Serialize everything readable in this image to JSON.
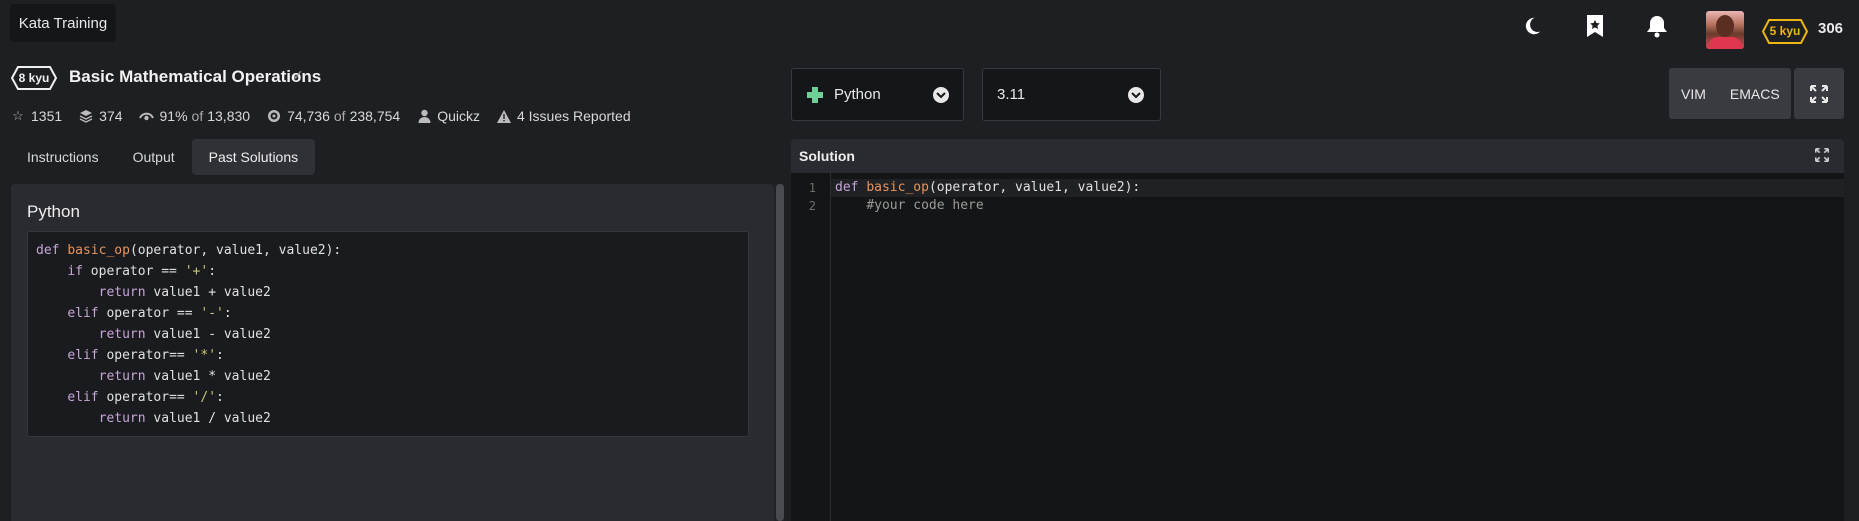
{
  "nav": {
    "brand": "Kata Training",
    "rank_badge": "5 kyu",
    "honor": "306",
    "rank_color": "#ecb613"
  },
  "kata": {
    "kyu": "8 kyu",
    "title": "Basic Mathematical Operations",
    "stats": {
      "stars": "1351",
      "collections": "374",
      "satisfaction": "91%",
      "satisfaction_of": "of",
      "satisfaction_total": "13,830",
      "completed": "74,736",
      "completed_of": "of",
      "completed_total": "238,754",
      "author": "Quickz",
      "issues": "4 Issues Reported"
    }
  },
  "tabs": [
    "Instructions",
    "Output",
    "Past Solutions"
  ],
  "active_tab": "Past Solutions",
  "past_solution": {
    "language": "Python",
    "code": [
      [
        [
          "kw",
          "def "
        ],
        [
          "fn",
          "basic_op"
        ],
        [
          "",
          "(operator, value1, value2):"
        ]
      ],
      [
        [
          "",
          "    "
        ],
        [
          "kw",
          "if"
        ],
        [
          "",
          " operator == "
        ],
        [
          "str",
          "'+'"
        ],
        [
          "",
          ":"
        ]
      ],
      [
        [
          "",
          "        "
        ],
        [
          "kw",
          "return"
        ],
        [
          "",
          " value1 + value2"
        ]
      ],
      [
        [
          "",
          "    "
        ],
        [
          "kw",
          "elif"
        ],
        [
          "",
          " operator == "
        ],
        [
          "str",
          "'-'"
        ],
        [
          "",
          ":"
        ]
      ],
      [
        [
          "",
          "        "
        ],
        [
          "kw",
          "return"
        ],
        [
          "",
          " value1 - value2"
        ]
      ],
      [
        [
          "",
          "    "
        ],
        [
          "kw",
          "elif"
        ],
        [
          "",
          " operator== "
        ],
        [
          "str",
          "'*'"
        ],
        [
          "",
          ":"
        ]
      ],
      [
        [
          "",
          "        "
        ],
        [
          "kw",
          "return"
        ],
        [
          "",
          " value1 * value2"
        ]
      ],
      [
        [
          "",
          "    "
        ],
        [
          "kw",
          "elif"
        ],
        [
          "",
          " operator== "
        ],
        [
          "str",
          "'/'"
        ],
        [
          "",
          ":"
        ]
      ],
      [
        [
          "",
          "        "
        ],
        [
          "kw",
          "return"
        ],
        [
          "",
          " value1 / value2"
        ]
      ]
    ]
  },
  "editor": {
    "language": "Python",
    "version": "3.11",
    "keybindings": [
      "VIM",
      "EMACS"
    ],
    "header": "Solution",
    "line_numbers": [
      "1",
      "2"
    ],
    "code": [
      [
        [
          "kw",
          "def "
        ],
        [
          "fn",
          "basic_op"
        ],
        [
          "",
          "(operator, value1, value2):"
        ]
      ],
      [
        [
          "",
          "    "
        ],
        [
          "cm",
          "#your code here"
        ]
      ]
    ]
  },
  "icons": {
    "theme": "moon-icon",
    "bookmark": "bookmark-star-icon",
    "notifications": "bell-icon",
    "language": "python-icon",
    "fullscreen": "expand-icon"
  }
}
